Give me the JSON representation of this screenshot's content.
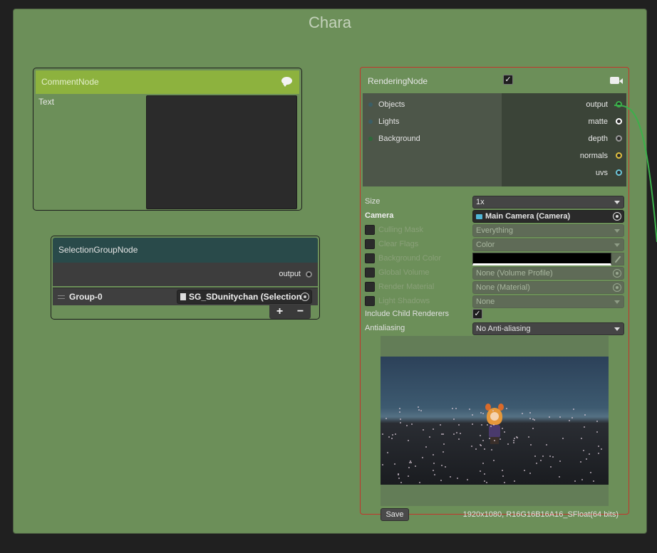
{
  "group": {
    "title": "Chara"
  },
  "comment_node": {
    "title": "CommentNode",
    "text_label": "Text",
    "text_value": ""
  },
  "selection_group_node": {
    "title": "SelectionGroupNode",
    "output_label": "output",
    "row_label": "Group-0",
    "row_object": "SG_SDunitychan (Selection",
    "add_label": "+",
    "remove_label": "−"
  },
  "rendering_node": {
    "title": "RenderingNode",
    "enabled_mark": "✓",
    "inputs": [
      "Objects",
      "Lights",
      "Background"
    ],
    "outputs": [
      {
        "name": "output",
        "color": "#3bb04a"
      },
      {
        "name": "matte",
        "color": "#ffffff"
      },
      {
        "name": "depth",
        "color": "#9a9a9a"
      },
      {
        "name": "normals",
        "color": "#e0c040"
      },
      {
        "name": "uvs",
        "color": "#6cc6d8"
      }
    ],
    "props": {
      "size_label": "Size",
      "size_value": "1x",
      "camera_label": "Camera",
      "camera_value": "Main Camera (Camera)",
      "culling_label": "Culling Mask",
      "culling_value": "Everything",
      "clear_label": "Clear Flags",
      "clear_value": "Color",
      "bg_color_label": "Background Color",
      "bg_color": "#000000",
      "volume_label": "Global Volume",
      "volume_value": "None (Volume Profile)",
      "material_label": "Render Material",
      "material_value": "None (Material)",
      "shadows_label": "Light Shadows",
      "shadows_value": "None",
      "child_label": "Include Child Renderers",
      "child_mark": "✓",
      "aa_label": "Antialiasing",
      "aa_value": "No Anti-aliasing"
    },
    "save_label": "Save",
    "resolution": "1920x1080, R16G16B16A16_SFloat(64 bits)"
  },
  "colors": {
    "canvas": "#6c8f59",
    "comment_header": "#8db23e",
    "selection_header": "#294a4a",
    "selected_border": "#c2352c",
    "edge": "#3bb04a"
  }
}
